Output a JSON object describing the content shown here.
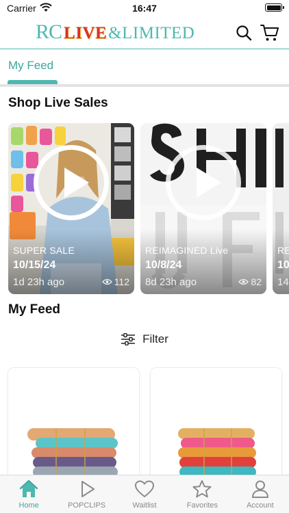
{
  "status_bar": {
    "carrier": "Carrier",
    "time": "16:47"
  },
  "header": {
    "logo": {
      "rc": "RC",
      "live": "LIVE",
      "limited": "&LIMITED"
    },
    "icons": {
      "search": "search-icon",
      "cart": "cart-icon"
    }
  },
  "tabs": [
    {
      "label": "My Feed",
      "active": true
    }
  ],
  "live_sales": {
    "title": "Shop Live Sales",
    "cards": [
      {
        "title": "SUPER SALE",
        "date": "10/15/24",
        "ago": "1d 23h ago",
        "views": "112"
      },
      {
        "title": "REIMAGINED Live",
        "date": "10/8/24",
        "ago": "8d 23h ago",
        "views": "82"
      },
      {
        "title": "RE",
        "date": "10",
        "ago": "14",
        "views": ""
      }
    ]
  },
  "feed": {
    "title": "My Feed",
    "filter_label": "Filter",
    "products": [
      {
        "image": "stacked-bangle-bracelets-orange-teal"
      },
      {
        "image": "stacked-bangle-bracelets-pink-red-teal"
      }
    ]
  },
  "bottom_nav": [
    {
      "label": "Home",
      "icon": "home-icon",
      "active": true
    },
    {
      "label": "POPCLIPS",
      "icon": "play-icon",
      "active": false
    },
    {
      "label": "Waitlist",
      "icon": "heart-icon",
      "active": false
    },
    {
      "label": "Favorites",
      "icon": "star-icon",
      "active": false
    },
    {
      "label": "Account",
      "icon": "account-icon",
      "active": false
    }
  ],
  "colors": {
    "accent": "#4db8b0",
    "accent_text": "#3aa8a0",
    "logo_red": "#d7322b",
    "nav_inactive": "#8a8a8a"
  }
}
